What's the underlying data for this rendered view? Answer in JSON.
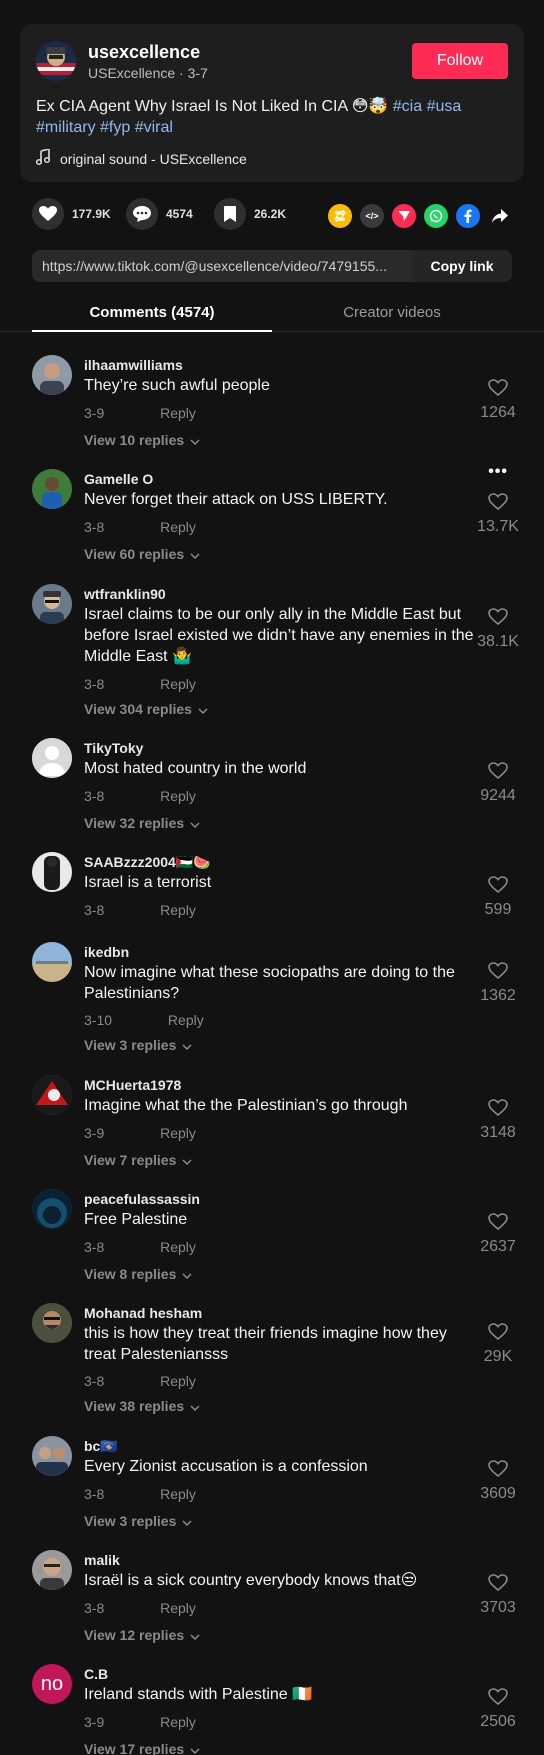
{
  "post": {
    "username": "usexcellence",
    "display_name": "USExcellence",
    "date": "3-7",
    "separator": " · ",
    "follow_label": "Follow",
    "caption": "Ex CIA Agent Why Israel Is Not Liked In CIA 😳🤯",
    "hashtags": [
      "#cia",
      "#usa",
      "#military",
      "#fyp",
      "#viral"
    ],
    "sound": "original sound - USExcellence"
  },
  "actions": {
    "likes": "177.9K",
    "comments": "4574",
    "saves": "26.2K"
  },
  "share": {
    "embed_glyph": "</>"
  },
  "link": {
    "url": "https://www.tiktok.com/@usexcellence/video/7479155...",
    "copy_label": "Copy link"
  },
  "tabs": {
    "comments": "Comments (4574)",
    "creator": "Creator videos"
  },
  "comments": [
    {
      "user": "ilhaamwilliams",
      "text": "They’re such awful people",
      "date": "3-9",
      "reply": "Reply",
      "likes": "1264",
      "view": "View 10 replies"
    },
    {
      "user": "Gamelle O",
      "text": "Never forget their attack on USS LIBERTY.",
      "date": "3-8",
      "reply": "Reply",
      "likes": "13.7K",
      "view": "View 60 replies"
    },
    {
      "user": "wtfranklin90",
      "text": "Israel claims to be our only ally in the Middle East but before Israel existed we didn’t have any enemies in the Middle East 🤷‍♂️",
      "date": "3-8",
      "reply": "Reply",
      "likes": "38.1K",
      "view": "View 304 replies"
    },
    {
      "user": "TikyToky",
      "text": "Most hated country in the world",
      "date": "3-8",
      "reply": "Reply",
      "likes": "9244",
      "view": "View 32 replies"
    },
    {
      "user": "SAABzzz2004🇵🇸🍉",
      "text": "Israel is a terrorist",
      "date": "3-8",
      "reply": "Reply",
      "likes": "599",
      "view": ""
    },
    {
      "user": "ikedbn",
      "text": "Now imagine what these sociopaths are doing to the Palestinians?",
      "date": "3-10",
      "reply": "Reply",
      "likes": "1362",
      "view": "View 3 replies"
    },
    {
      "user": "MCHuerta1978",
      "text": "Imagine what the the Palestinian’s go through",
      "date": "3-9",
      "reply": "Reply",
      "likes": "3148",
      "view": "View 7 replies"
    },
    {
      "user": "peacefulassassin",
      "text": "Free Palestine",
      "date": "3-8",
      "reply": "Reply",
      "likes": "2637",
      "view": "View 8 replies"
    },
    {
      "user": "Mohanad hesham",
      "text": "this is how they treat their friends imagine how they treat Palesteniansss",
      "date": "3-8",
      "reply": "Reply",
      "likes": "29K",
      "view": "View 38 replies"
    },
    {
      "user": "bc🇽🇰",
      "text": "Every Zionist accusation is a confession",
      "date": "3-8",
      "reply": "Reply",
      "likes": "3609",
      "view": "View 3 replies"
    },
    {
      "user": "malik",
      "text": "Israël is a sick country everybody knows that😒",
      "date": "3-8",
      "reply": "Reply",
      "likes": "3703",
      "view": "View 12 replies"
    },
    {
      "user": "C.B",
      "text": "Ireland stands with Palestine 🇮🇪",
      "date": "3-9",
      "reply": "Reply",
      "likes": "2506",
      "view": "View 17 replies",
      "avatar_initials": "no"
    }
  ],
  "more_options_glyph": "•••",
  "colors": {
    "background": "#121212",
    "card": "#1e1e1e",
    "follow": "#fe2c55",
    "hashtag": "#8fb9ee",
    "muted": "#8a8a8a"
  }
}
